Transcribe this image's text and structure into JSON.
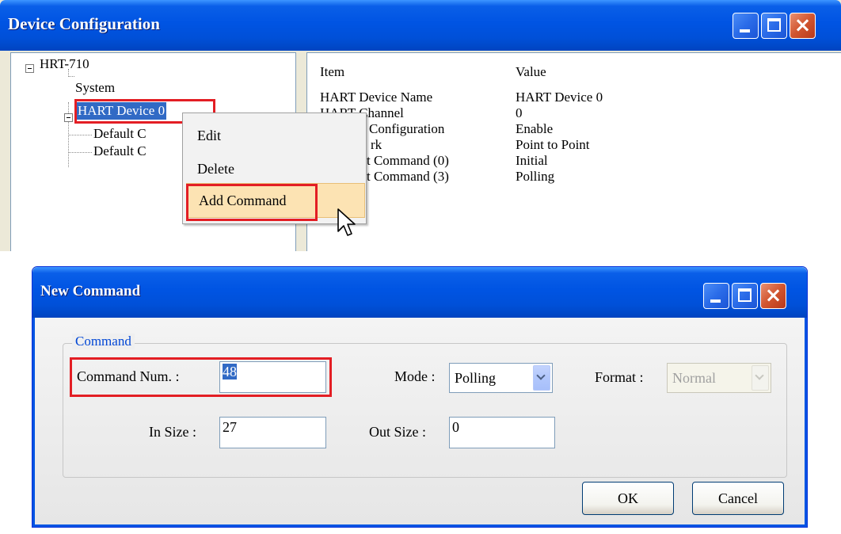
{
  "colors": {
    "title_bar": "#0054E3",
    "selection": "#316AC5",
    "highlight_box": "#E31E24",
    "menu_hover": "#FCE3B3"
  },
  "device_config": {
    "title": "Device Configuration",
    "tree": {
      "root": "HRT-710",
      "children": [
        "System",
        "HART Device 0"
      ],
      "sub_children": [
        "Default C",
        "Default C"
      ]
    },
    "grid": {
      "headers": {
        "item": "Item",
        "value": "Value"
      },
      "rows": [
        {
          "item": "HART Device Name",
          "value": "HART Device 0"
        },
        {
          "item": "HART Channel",
          "value": "0"
        },
        {
          "item": "Configuration",
          "value": "Enable"
        },
        {
          "item": "rk",
          "value": "Point to Point"
        },
        {
          "item": "t Command (0)",
          "value": "Initial"
        },
        {
          "item": "t Command (3)",
          "value": "Polling"
        }
      ]
    },
    "context_menu": {
      "items": [
        "Edit",
        "Delete",
        "Add Command"
      ]
    }
  },
  "new_command": {
    "title": "New Command",
    "group_label": "Command",
    "command_num": {
      "label": "Command Num. :",
      "value": "48"
    },
    "mode": {
      "label": "Mode :",
      "value": "Polling"
    },
    "format": {
      "label": "Format :",
      "value": "Normal"
    },
    "in_size": {
      "label": "In Size :",
      "value": "27"
    },
    "out_size": {
      "label": "Out Size :",
      "value": "0"
    },
    "buttons": {
      "ok": "OK",
      "cancel": "Cancel"
    }
  },
  "icons": [
    "minimize-icon",
    "maximize-icon",
    "close-icon",
    "mouse-cursor-icon",
    "expand-collapse-icon"
  ]
}
